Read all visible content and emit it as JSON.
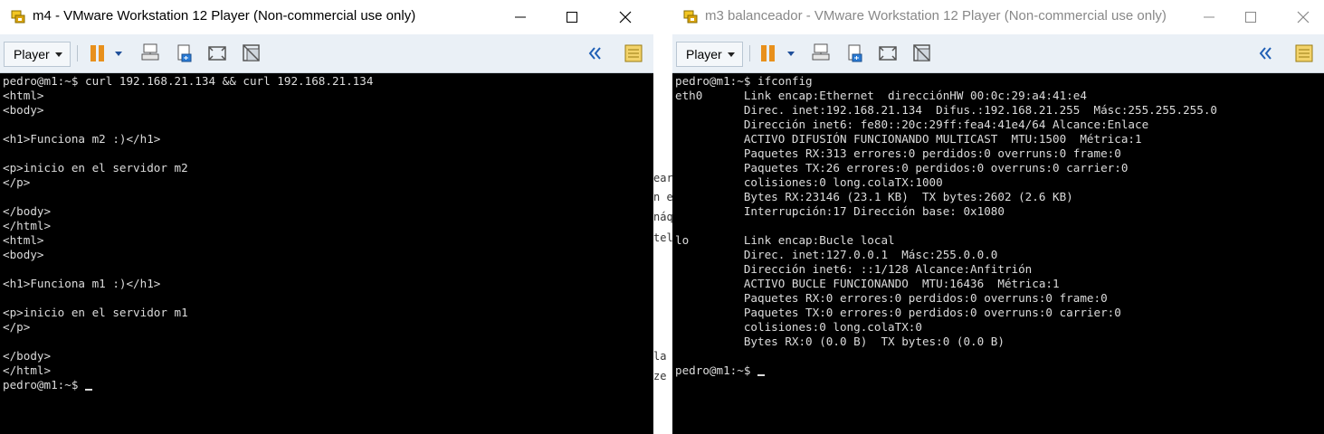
{
  "left_window": {
    "title": "m4 - VMware Workstation 12 Player (Non-commercial use only)",
    "player_menu": "Player",
    "console_lines": [
      "pedro@m1:~$ curl 192.168.21.134 && curl 192.168.21.134",
      "<html>",
      "<body>",
      "",
      "<h1>Funciona m2 :)</h1>",
      "",
      "<p>inicio en el servidor m2",
      "</p>",
      "",
      "</body>",
      "</html>",
      "<html>",
      "<body>",
      "",
      "<h1>Funciona m1 :)</h1>",
      "",
      "<p>inicio en el servidor m1",
      "</p>",
      "",
      "</body>",
      "</html>"
    ],
    "prompt": "pedro@m1:~$ "
  },
  "right_window": {
    "title": "m3 balanceador - VMware Workstation 12 Player (Non-commercial use only)",
    "player_menu": "Player",
    "console_lines": [
      "pedro@m1:~$ ifconfig",
      "eth0      Link encap:Ethernet  direcciónHW 00:0c:29:a4:41:e4",
      "          Direc. inet:192.168.21.134  Difus.:192.168.21.255  Másc:255.255.255.0",
      "          Dirección inet6: fe80::20c:29ff:fea4:41e4/64 Alcance:Enlace",
      "          ACTIVO DIFUSIÓN FUNCIONANDO MULTICAST  MTU:1500  Métrica:1",
      "          Paquetes RX:313 errores:0 perdidos:0 overruns:0 frame:0",
      "          Paquetes TX:26 errores:0 perdidos:0 overruns:0 carrier:0",
      "          colisiones:0 long.colaTX:1000",
      "          Bytes RX:23146 (23.1 KB)  TX bytes:2602 (2.6 KB)",
      "          Interrupción:17 Dirección base: 0x1080",
      "",
      "lo        Link encap:Bucle local",
      "          Direc. inet:127.0.0.1  Másc:255.0.0.0",
      "          Dirección inet6: ::1/128 Alcance:Anfitrión",
      "          ACTIVO BUCLE FUNCIONANDO  MTU:16436  Métrica:1",
      "          Paquetes RX:0 errores:0 perdidos:0 overruns:0 frame:0",
      "          Paquetes TX:0 errores:0 perdidos:0 overruns:0 carrier:0",
      "          colisiones:0 long.colaTX:0",
      "          Bytes RX:0 (0.0 B)  TX bytes:0 (0.0 B)",
      ""
    ],
    "prompt": "pedro@m1:~$ "
  },
  "background_fragments": [
    "ear",
    "n e",
    "náq",
    "tel",
    "la",
    "ze"
  ],
  "colors": {
    "console_bg": "#000000",
    "console_fg": "#dcdcdc",
    "toolbar_bg": "#eaf0f6",
    "accent_blue": "#1f6fc5",
    "pause_orange": "#e8901c"
  },
  "icons": {
    "app": "vmware-player-icon",
    "pause": "pause-icon",
    "dropdown": "chevron-down-icon",
    "network": "network-devices-icon",
    "usb": "removable-devices-icon",
    "fullscreen": "fullscreen-icon",
    "unity": "unity-icon",
    "collapse": "double-chevron-left-icon",
    "library": "library-icon"
  }
}
